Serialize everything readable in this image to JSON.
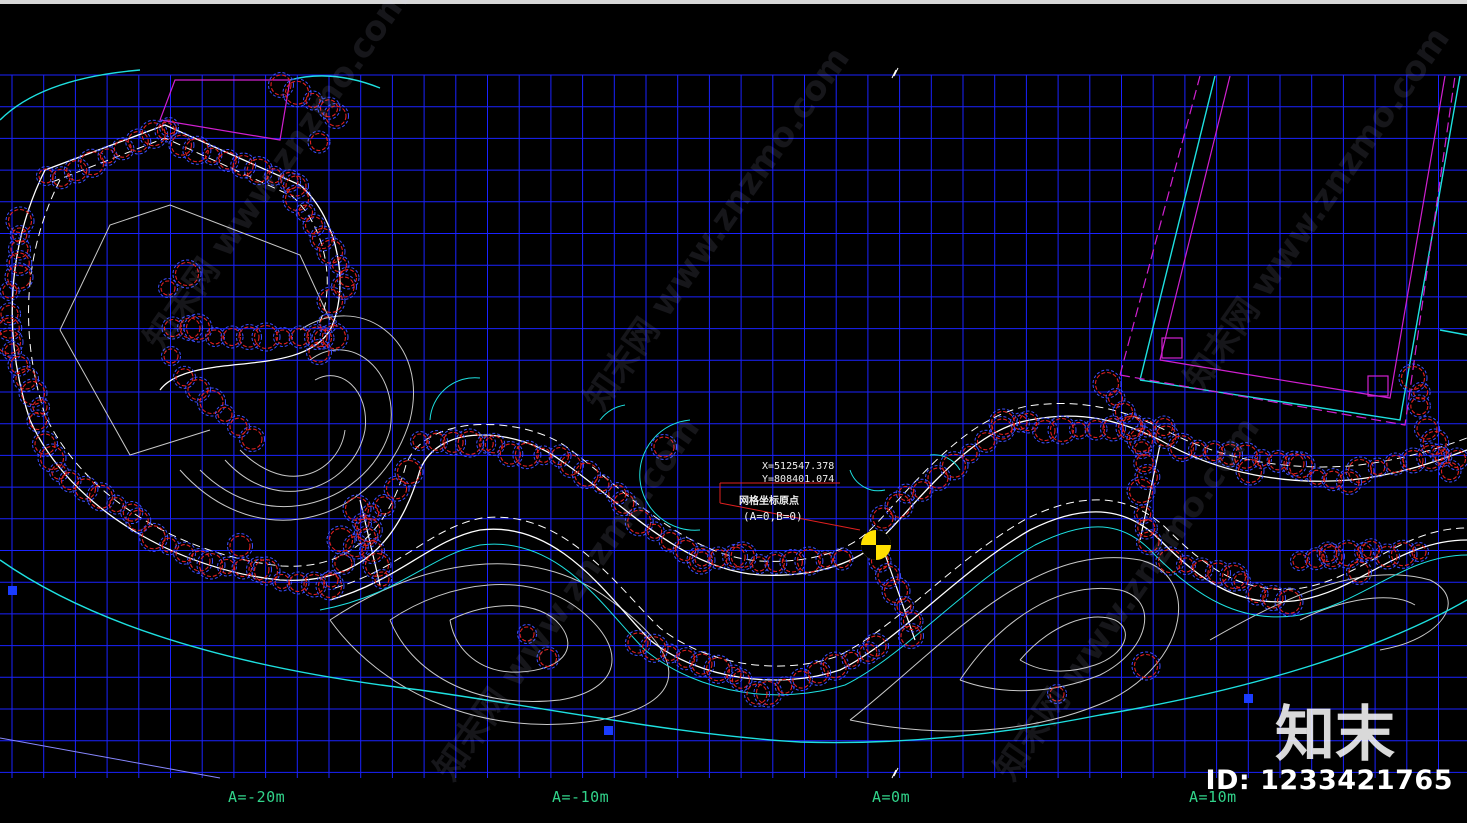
{
  "axis_labels": {
    "a_neg20": "A=-20m",
    "a_neg10": "A=-10m",
    "a_0": "A=0m",
    "a_10": "A=10m"
  },
  "origin_marker": {
    "x_coord": "X=512547.378",
    "y_coord": "Y=808401.074",
    "title": "网格坐标原点",
    "subtitle": "(A=0,B=0)"
  },
  "brand": {
    "logo_text": "知末",
    "id_text": "ID: 1233421765",
    "watermark_text": "知末网 www.znzmo.com"
  },
  "colors": {
    "background": "#000000",
    "grid": "#1a22ff",
    "path_edge": "#ffffff",
    "shrub_red": "#e02020",
    "shrub_blue": "#3b4dff",
    "contour": "#c8c8c8",
    "boundary": "#1ee0e0",
    "building": "#d020d0",
    "origin": "#ffe000",
    "axis_label": "#31d38a"
  }
}
